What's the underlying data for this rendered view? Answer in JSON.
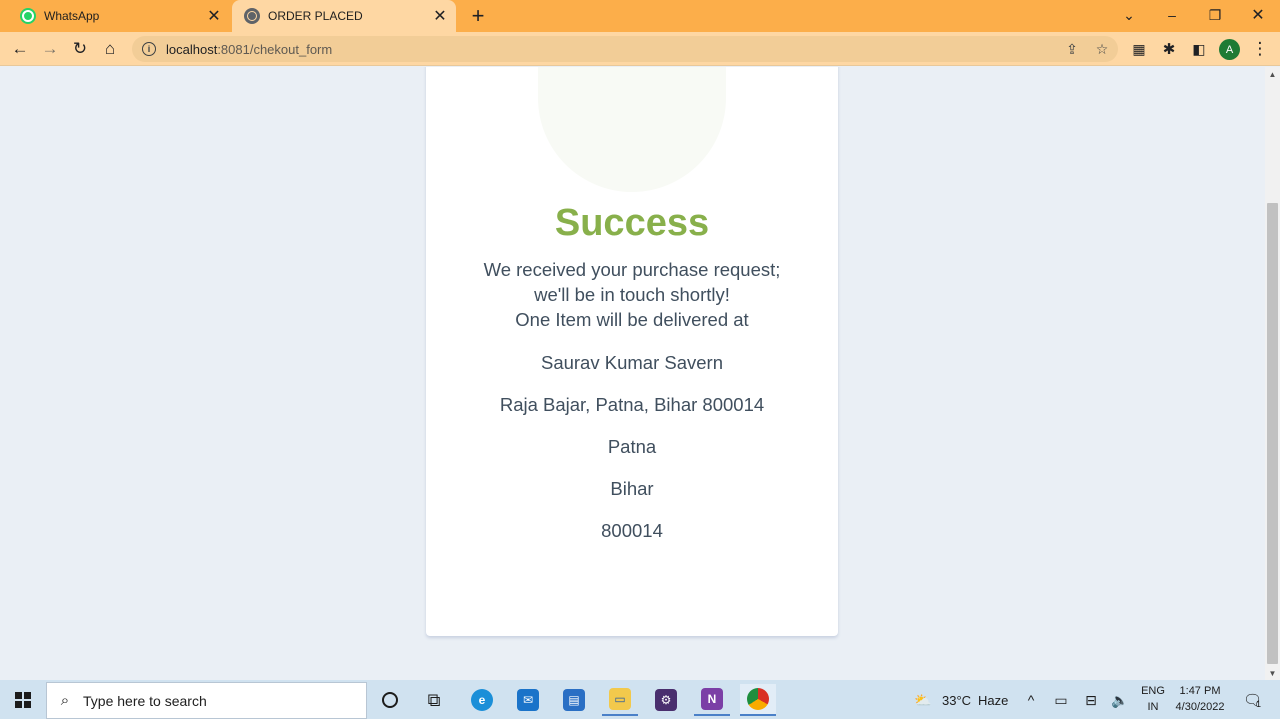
{
  "browser": {
    "tabs": [
      {
        "title": "WhatsApp",
        "favicon": "whatsapp-icon",
        "active": false
      },
      {
        "title": "ORDER PLACED",
        "favicon": "globe-icon",
        "active": true
      }
    ],
    "url_host": "localhost",
    "url_path": ":8081/chekout_form",
    "profile_initial": "A"
  },
  "page": {
    "heading": "Success",
    "lines": [
      "We received your purchase request;",
      "we'll be in touch shortly!",
      "One Item will be delivered at"
    ],
    "address": {
      "name": "Saurav Kumar Savern",
      "street": "Raja Bajar, Patna, Bihar 800014",
      "city": "Patna",
      "state": "Bihar",
      "pin": "800014"
    },
    "colors": {
      "accent": "#88b04b",
      "text": "#404f5e",
      "background": "#eaeff5"
    }
  },
  "taskbar": {
    "search_placeholder": "Type here to search",
    "weather_temp": "33°C",
    "weather_desc": "Haze",
    "lang_top": "ENG",
    "lang_bottom": "IN",
    "time": "1:47 PM",
    "date": "4/30/2022",
    "notification_count": "1"
  }
}
